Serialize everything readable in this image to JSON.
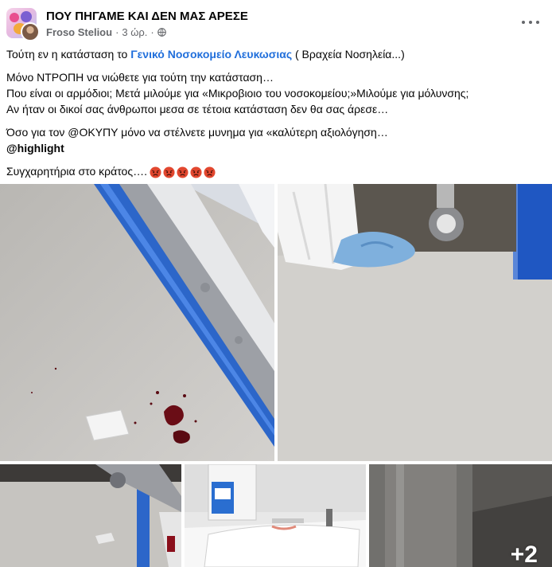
{
  "post": {
    "group_name": "ΠΟΥ ΠΗΓΑΜΕ ΚΑΙ ΔΕΝ ΜΑΣ ΑΡΕΣΕ",
    "author": "Froso Steliou",
    "time": "3 ώρ.",
    "separator": "·",
    "privacy_icon": "globe-icon",
    "more_icon": "more-options-icon"
  },
  "content": {
    "line1_prefix": "Τούτη  εν η κατάσταση το ",
    "line1_link": "Γενικό Νοσοκομείο Λευκωσιας",
    "line1_suffix": " ( Βραχεία Νοσηλεία...)",
    "para2_line1": "Μόνο ΝΤΡΟΠΗ να νιώθετε για τούτη την κατάσταση…",
    "para2_line2": "Που είναι οι αρμόδιοι; Μετά μιλούμε για «Μικροβιοιο του νοσοκομείου;»Μιλούμε για μόλυνσης;",
    "para2_line3": "Αν ήταν οι δικοί σας άνθρωποι μεσα σε τέτοια κατάσταση δεν θα σας άρεσε…",
    "para3_line1": "Όσο για τον @ΟΚΥΠΥ μόνο να στέλνετε μυνημα για «καλύτερη αξιολόγηση…",
    "para3_mention": "@highlight",
    "para4_text": "Συγχαρητήρια στο κράτος….",
    "emoji_icon": "angry-face-icon",
    "emoji_count": 5
  },
  "photos": {
    "more_count": "+2",
    "colors": {
      "floor": "#c9c7c4",
      "blue_rail": "#2c66c9",
      "blood": "#6a0d16",
      "link": "#216fdb"
    }
  }
}
